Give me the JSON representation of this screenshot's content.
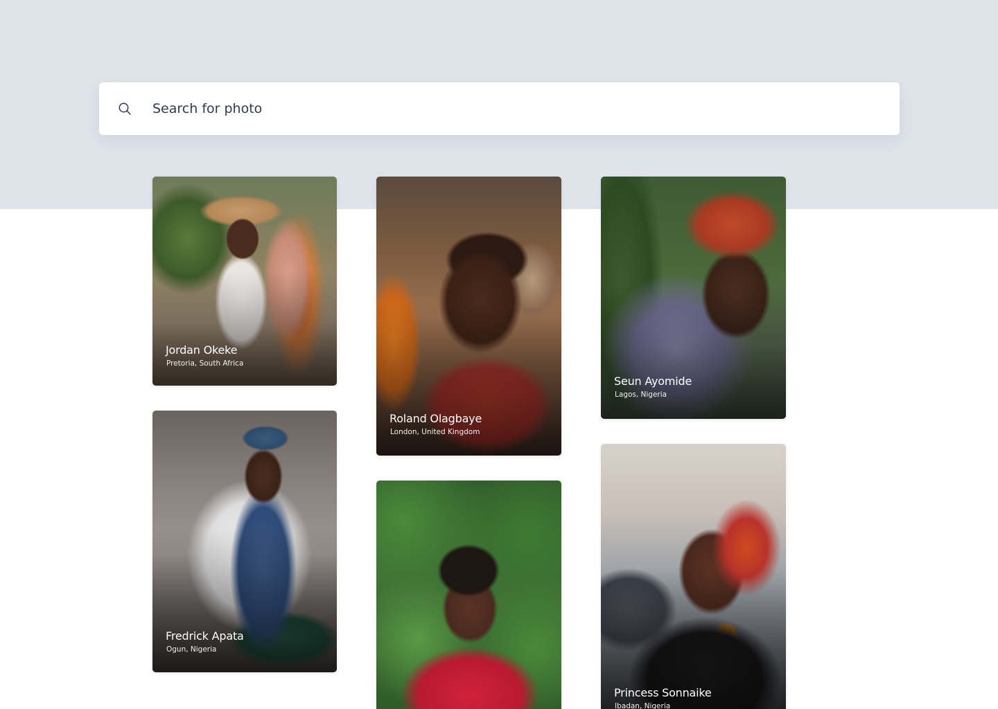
{
  "search": {
    "placeholder": "Search for photo",
    "value": ""
  },
  "gallery": {
    "cards": [
      {
        "name": "Jordan Okeke",
        "location": "Pretoria, South Africa"
      },
      {
        "name": "Roland Olagbaye",
        "location": "London, United Kingdom"
      },
      {
        "name": "Seun Ayomide",
        "location": "Lagos, Nigeria"
      },
      {
        "name": "Fredrick Apata",
        "location": "Ogun, Nigeria"
      },
      {
        "name": "",
        "location": ""
      },
      {
        "name": "Princess Sonnaike",
        "location": "Ibadan, Nigeria"
      }
    ]
  },
  "colors": {
    "top_band": "#dfe3ea",
    "search_text": "#2d3b52",
    "caption_text": "#ffffff"
  },
  "icons": {
    "search": "search-icon"
  }
}
